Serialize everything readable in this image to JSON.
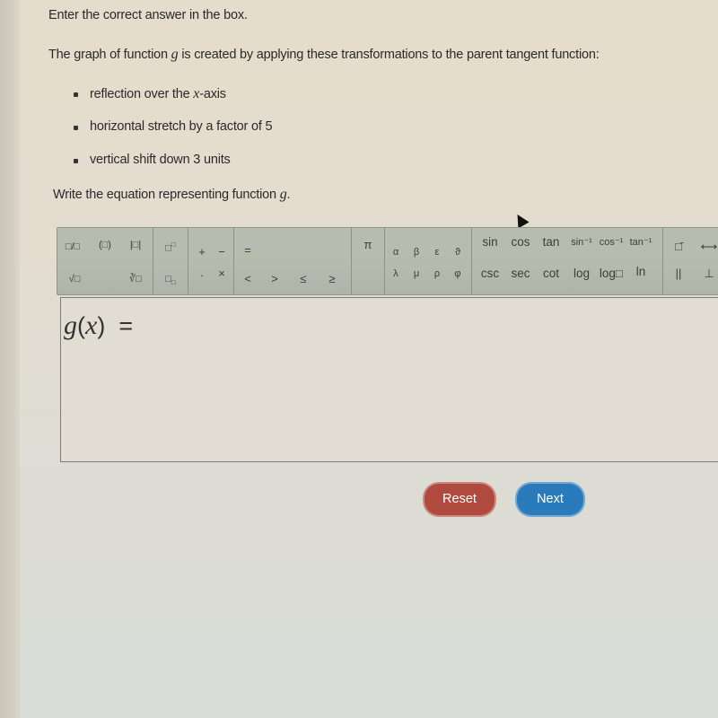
{
  "instructions": "Enter the correct answer in the box.",
  "question": {
    "prefix": "The graph of function ",
    "var": "g",
    "suffix": " is created by applying these transformations to the parent tangent function:"
  },
  "transformations": [
    {
      "prefix": "reflection over the ",
      "var": "x",
      "suffix": "-axis"
    },
    {
      "prefix": "horizontal stretch by a factor of 5",
      "var": "",
      "suffix": ""
    },
    {
      "prefix": "vertical shift down 3 units",
      "var": "",
      "suffix": ""
    }
  ],
  "prompt": {
    "prefix": "Write the equation representing function ",
    "var": "g",
    "suffix": "."
  },
  "toolbar": {
    "group1": {
      "fraction": "□/□",
      "parens": "(□)",
      "abs": "|□|",
      "sqrt": "√□",
      "nthroot": "∛□"
    },
    "group2": {
      "superscript": "□",
      "subscript": "□"
    },
    "group3": {
      "plus": "+",
      "minus": "−",
      "dot": "·",
      "times": "×"
    },
    "group4": {
      "equals": "=",
      "lt": "<",
      "gt": ">",
      "le": "≤",
      "ge": "≥"
    },
    "group5": {
      "pi": "π"
    },
    "greek": [
      "α",
      "β",
      "ε",
      "ϑ",
      "λ",
      "μ",
      "ρ",
      "φ"
    ],
    "trig_row1": [
      "sin",
      "cos",
      "tan",
      "sin⁻¹",
      "cos⁻¹",
      "tan⁻¹"
    ],
    "trig_row2": [
      "csc",
      "sec",
      "cot",
      "log",
      "log□",
      "ln"
    ],
    "geometry": {
      "overline": "□̄",
      "parallel": "||",
      "ray": "⟷",
      "perpendicular": "⊥"
    }
  },
  "answer": {
    "label_fn": "g",
    "label_var": "x",
    "value": ""
  },
  "buttons": {
    "reset": "Reset",
    "next": "Next"
  },
  "colors": {
    "reset": "#b04a3e",
    "next": "#2a7bbb",
    "toolbar": "#b5bbae"
  }
}
